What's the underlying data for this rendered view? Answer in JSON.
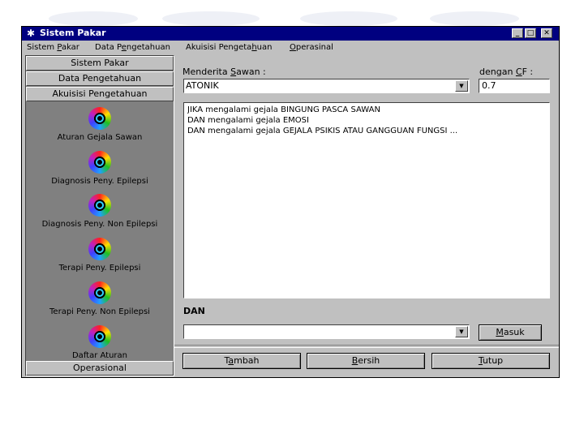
{
  "window": {
    "title": "Sistem Pakar",
    "controls": {
      "minimize": "_",
      "maximize": "□",
      "close": "✕"
    }
  },
  "menubar": [
    {
      "pre": "Sistem ",
      "ul": "P",
      "post": "akar"
    },
    {
      "pre": "Data P",
      "ul": "e",
      "post": "ngetahuan"
    },
    {
      "pre": "Akuisisi Pengeta",
      "ul": "h",
      "post": "uan"
    },
    {
      "pre": "",
      "ul": "O",
      "post": "perasinal"
    }
  ],
  "sidebar": {
    "headers": [
      "Sistem Pakar",
      "Data Pengetahuan",
      "Akuisisi Pengetahuan"
    ],
    "items": [
      "Aturan Gejala Sawan",
      "Diagnosis Peny. Epilepsi",
      "Diagnosis Peny. Non Epilepsi",
      "Terapi Peny. Epilepsi",
      "Terapi Peny. Non Epilepsi",
      "Daftar Aturan"
    ],
    "footer": "Operasional"
  },
  "form": {
    "penderita_label": {
      "pre": "Menderita ",
      "ul": "S",
      "post": "awan  :"
    },
    "penderita_value": "ATONIK",
    "cf_label": {
      "pre": "dengan ",
      "ul": "C",
      "post": "F :"
    },
    "cf_value": "0.7",
    "rules": [
      "JIKA mengalami gejala BINGUNG PASCA SAWAN",
      "DAN mengalami gejala EMOSI",
      "DAN mengalami gejala GEJALA PSIKIS ATAU GANGGUAN FUNGSI ..."
    ],
    "dan_label": "DAN",
    "dan_value": "",
    "masuk": {
      "pre": "",
      "ul": "M",
      "post": "asuk"
    }
  },
  "buttons": {
    "tambah": {
      "pre": "T",
      "ul": "a",
      "post": "mbah"
    },
    "bersih": {
      "pre": "",
      "ul": "B",
      "post": "ersih"
    },
    "tutup": {
      "pre": "",
      "ul": "T",
      "post": "utup"
    }
  },
  "icons": {
    "app": "star-icon",
    "item": "ring-icon",
    "dropdown": "arrow-down-icon"
  },
  "colors": {
    "titlebar": "#000080",
    "face": "#c0c0c0",
    "sidebar": "#808080"
  }
}
